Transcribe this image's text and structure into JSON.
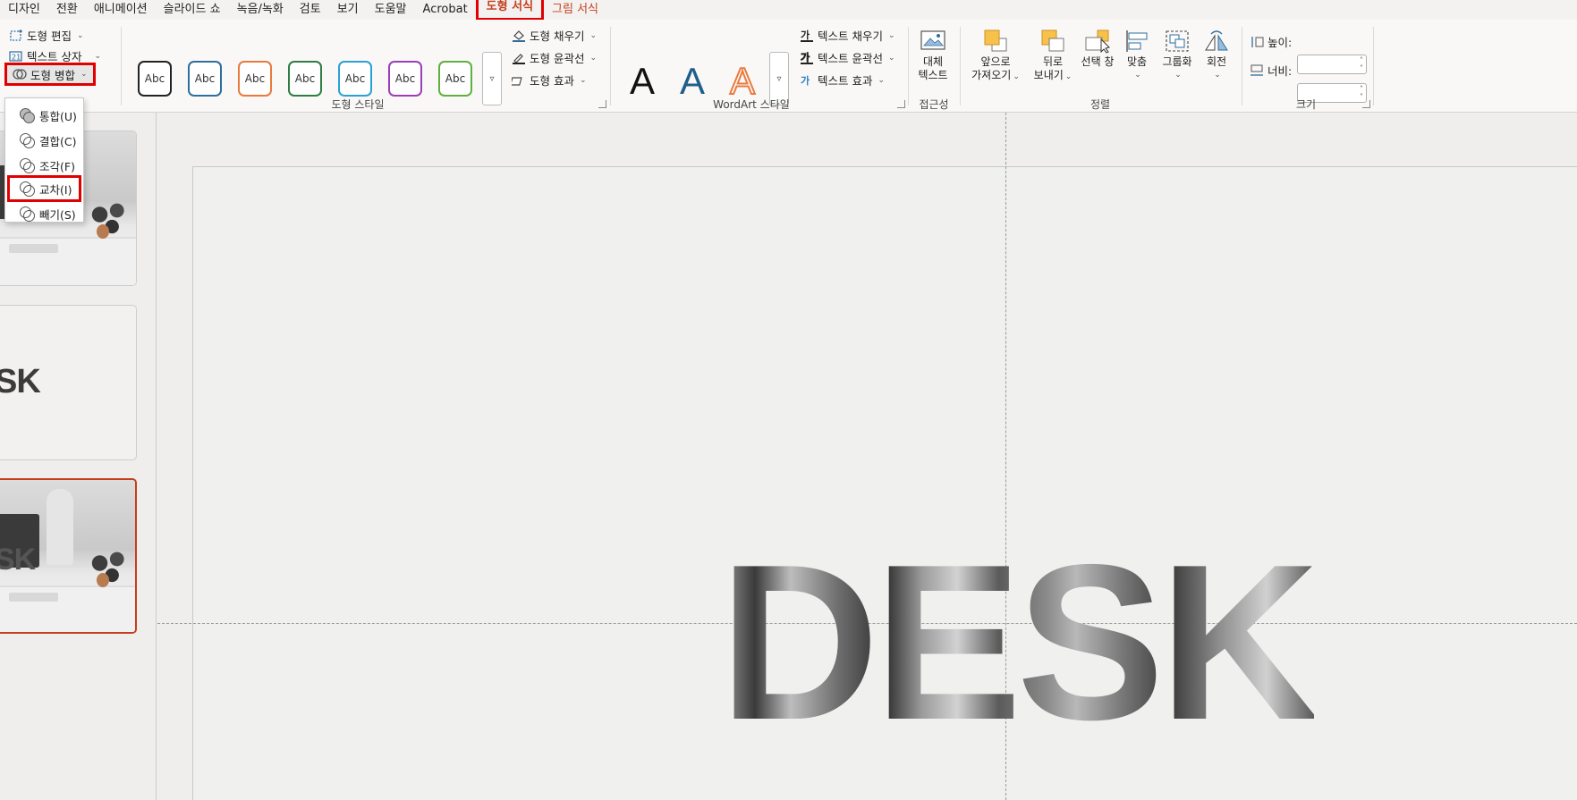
{
  "menu": {
    "tabs": [
      "디자인",
      "전환",
      "애니메이션",
      "슬라이드 쇼",
      "녹음/녹화",
      "검토",
      "보기",
      "도움말",
      "Acrobat"
    ],
    "active_tab": "도형 서식",
    "context_tab": "그림 서식"
  },
  "ribbon": {
    "insert": {
      "edit_shape": "도형 편집",
      "text_box": "텍스트 상자",
      "merge_shapes": "도형 병합"
    },
    "shape_styles": {
      "sample_text": "Abc",
      "colors": [
        "#222222",
        "#2e6e9e",
        "#e87a3e",
        "#2e7d44",
        "#2aa0d6",
        "#9b3fb8",
        "#5fb040"
      ],
      "fill": "도형 채우기",
      "outline": "도형 윤곽선",
      "effects": "도형 효과",
      "label": "도형 스타일"
    },
    "wordart": {
      "letter": "A",
      "colors": [
        "#111111",
        "#1f5f8b",
        "#e87a3e"
      ],
      "text_fill": "텍스트 채우기",
      "text_outline": "텍스트 윤곽선",
      "text_effects": "텍스트 효과",
      "label": "WordArt 스타일"
    },
    "accessibility": {
      "alt_text_line1": "대체",
      "alt_text_line2": "텍스트",
      "label": "접근성"
    },
    "arrange": {
      "bring_forward_line1": "앞으로",
      "bring_forward_line2": "가져오기",
      "send_backward_line1": "뒤로",
      "send_backward_line2": "보내기",
      "selection_pane": "선택 창",
      "align": "맞춤",
      "group": "그룹화",
      "rotate": "회전",
      "label": "정렬"
    },
    "size": {
      "height_label": "높이:",
      "width_label": "너비:",
      "height_value": "",
      "width_value": "",
      "label": "크기"
    }
  },
  "merge_menu": {
    "items": [
      "통합(U)",
      "결합(C)",
      "조각(F)",
      "교차(I)",
      "빼기(S)"
    ],
    "highlighted": "교차(I)"
  },
  "thumbnails": {
    "slide2_text": "SK",
    "slide3_text": "SK"
  },
  "slide": {
    "word": "DESK"
  }
}
